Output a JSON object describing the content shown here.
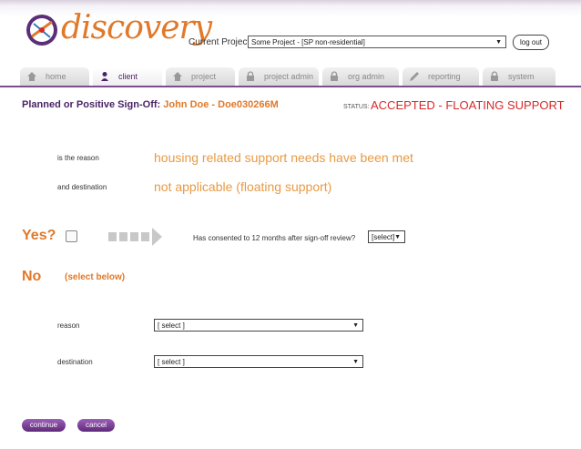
{
  "app": {
    "logo_text": "discovery"
  },
  "header": {
    "current_project_label": "Current Project",
    "project_selected": "Some Project - [SP non-residential]",
    "logout_label": "log out"
  },
  "tabs": [
    {
      "label": "home",
      "icon": "home-icon",
      "active": false
    },
    {
      "label": "client",
      "icon": "person-icon",
      "active": true
    },
    {
      "label": "project",
      "icon": "house-icon",
      "active": false
    },
    {
      "label": "project admin",
      "icon": "lock-icon",
      "active": false
    },
    {
      "label": "org admin",
      "icon": "lock-icon",
      "active": false
    },
    {
      "label": "reporting",
      "icon": "pen-icon",
      "active": false
    },
    {
      "label": "system",
      "icon": "lock-icon",
      "active": false
    }
  ],
  "page": {
    "title": "Planned or Positive Sign-Off:",
    "client_name": "John Doe - Doe030266M",
    "status_label": "STATUS:",
    "status_value": "ACCEPTED - FLOATING SUPPORT"
  },
  "summary": {
    "reason_label": "is the reason",
    "reason_value": "housing related support needs have been met",
    "destination_label": "and destination",
    "destination_value": "not applicable (floating support)"
  },
  "yes_section": {
    "label": "Yes?",
    "checked": false,
    "consent_label": "Has consented to 12 months after sign-off review?",
    "consent_select": "[select]"
  },
  "no_section": {
    "label": "No",
    "hint": "(select below)",
    "reason_label": "reason",
    "reason_select": "[ select ]",
    "destination_label": "destination",
    "destination_select": "[ select ]"
  },
  "footer": {
    "continue_label": "continue",
    "cancel_label": "cancel"
  },
  "colors": {
    "accent_purple": "#4a2466",
    "accent_orange": "#e0792a",
    "status_red": "#d62a2a"
  }
}
